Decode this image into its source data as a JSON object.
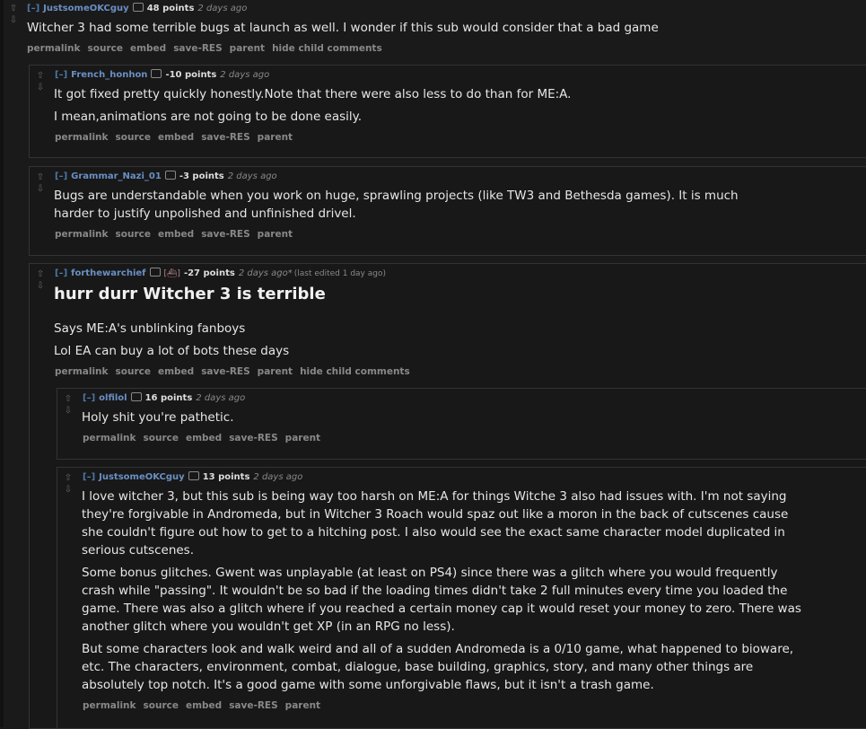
{
  "icons": {
    "upvote": "up-arrow-icon",
    "downvote": "down-arrow-icon",
    "userinfo": "tag-icon"
  },
  "comments": [
    {
      "collapse": "[–]",
      "author": "JustsomeOKCguy",
      "score": "48 points",
      "time": "2 days ago",
      "body": [
        "Witcher 3 had some terrible bugs at launch as well. I wonder if this sub would consider that a bad game"
      ],
      "buttons": [
        "permalink",
        "source",
        "embed",
        "save-RES",
        "parent",
        "hide child comments"
      ]
    },
    {
      "collapse": "[–]",
      "author": "French_honhon",
      "score": "-10 points",
      "time": "2 days ago",
      "body": [
        "It got fixed pretty quickly honestly.Note that there were also less to do than for ME:A.",
        "I mean,animations are not going to be done easily."
      ],
      "buttons": [
        "permalink",
        "source",
        "embed",
        "save-RES",
        "parent"
      ]
    },
    {
      "collapse": "[–]",
      "author": "Grammar_Nazi_01",
      "score": "-3 points",
      "time": "2 days ago",
      "body": [
        "Bugs are understandable when you work on huge, sprawling projects (like TW3 and Bethesda games). It is much",
        "harder to justify unpolished and unfinished drivel."
      ],
      "buttons": [
        "permalink",
        "source",
        "embed",
        "save-RES",
        "parent"
      ]
    },
    {
      "collapse": "[–]",
      "author": "forthewarchief",
      "flair": "[⛴]",
      "score": "-27 points",
      "time": "2 days ago*",
      "edited": "(last edited 1 day ago)",
      "heading": "hurr durr Witcher 3 is terrible",
      "body": [
        "Says ME:A's unblinking fanboys",
        "Lol EA can buy a lot of bots these days"
      ],
      "buttons": [
        "permalink",
        "source",
        "embed",
        "save-RES",
        "parent",
        "hide child comments"
      ]
    },
    {
      "collapse": "[–]",
      "author": "olfilol",
      "score": "16 points",
      "time": "2 days ago",
      "body": [
        "Holy shit you're pathetic."
      ],
      "buttons": [
        "permalink",
        "source",
        "embed",
        "save-RES",
        "parent"
      ]
    },
    {
      "collapse": "[–]",
      "author": "JustsomeOKCguy",
      "score": "13 points",
      "time": "2 days ago",
      "body": [
        "I love witcher 3, but this sub is being way too harsh on ME:A for things Witche 3 also had issues with. I'm not saying",
        "they're forgivable in Andromeda, but in Witcher 3 Roach would spaz out like a moron in the back of cutscenes cause",
        "she couldn't figure out how to get to a hitching post. I also would see the exact same character model duplicated in",
        "serious cutscenes.",
        "Some bonus glitches. Gwent was unplayable (at least on PS4) since there was a glitch where you would frequently",
        "crash while \"passing\". It wouldn't be so bad if the loading times didn't take 2 full minutes every time you loaded the",
        "game. There was also a glitch where if you reached a certain money cap it would reset your money to zero. There was",
        "another glitch where you wouldn't get XP (in an RPG no less).",
        "But some characters look and walk weird and all of a sudden Andromeda is a 0/10 game, what happened to bioware,",
        "etc. The characters, environment, combat, dialogue, base building, graphics, story, and many other things are",
        "absolutely top notch. It's a good game with some unforgivable flaws, but it isn't a trash game."
      ],
      "buttons": [
        "permalink",
        "source",
        "embed",
        "save-RES",
        "parent"
      ]
    }
  ]
}
